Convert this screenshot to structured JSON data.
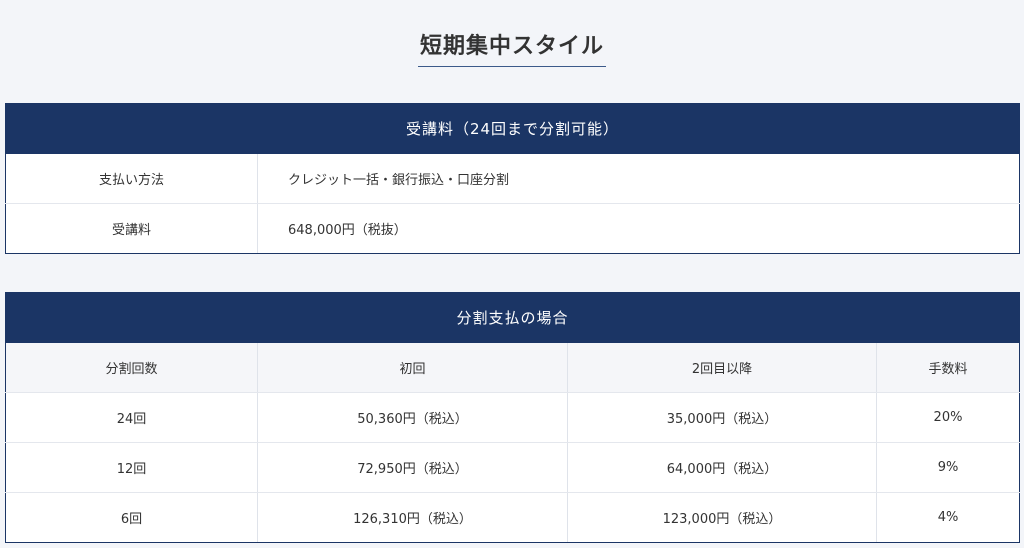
{
  "title": "短期集中スタイル",
  "fee_table": {
    "header": "受講料（24回まで分割可能）",
    "rows": [
      {
        "label": "支払い方法",
        "value": "クレジット一括・銀行振込・口座分割"
      },
      {
        "label": "受講料",
        "value": "648,000円（税抜）"
      }
    ]
  },
  "split_table": {
    "header": "分割支払の場合",
    "columns": [
      "分割回数",
      "初回",
      "2回目以降",
      "手数料"
    ],
    "rows": [
      [
        "24回",
        "50,360円（税込）",
        "35,000円（税込）",
        "20%"
      ],
      [
        "12回",
        "72,950円（税込）",
        "64,000円（税込）",
        "9%"
      ],
      [
        "6回",
        "126,310円（税込）",
        "123,000円（税込）",
        "4%"
      ]
    ]
  }
}
